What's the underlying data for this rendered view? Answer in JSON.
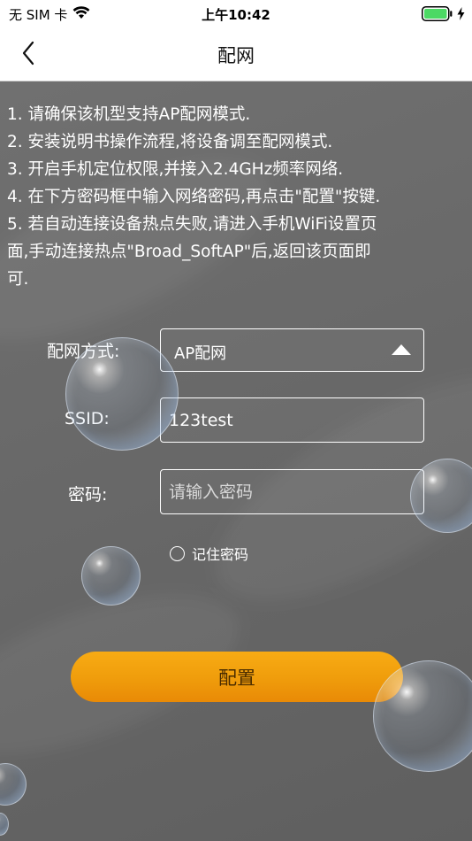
{
  "status_bar": {
    "carrier": "无 SIM 卡",
    "time": "上午10:42",
    "wifi_icon": "wifi-icon",
    "battery_icon": "battery-icon",
    "battery_color": "#4cd964"
  },
  "nav": {
    "title": "配网",
    "back_icon": "chevron-left-icon"
  },
  "instructions": [
    "1. 请确保该机型支持AP配网模式.",
    "2. 安装说明书操作流程,将设备调至配网模式.",
    "3. 开启手机定位权限,并接入2.4GHz频率网络.",
    "4. 在下方密码框中输入网络密码,再点击\"配置\"按键.",
    "5. 若自动连接设备热点失败,请进入手机WiFi设置页",
    "面,手动连接热点\"Broad_SoftAP\"后,返回该页面即",
    "可."
  ],
  "form": {
    "mode_label": "配网方式:",
    "mode_value": "AP配网",
    "ssid_label": "SSID:",
    "ssid_value": "123test",
    "password_label": "密码:",
    "password_placeholder": "请输入密码",
    "password_value": "",
    "remember_label": "记住密码",
    "remember_checked": false
  },
  "config_button_label": "配置",
  "colors": {
    "accent": "#f09e0c",
    "background": "#6a6a6a",
    "text": "#ffffff"
  }
}
